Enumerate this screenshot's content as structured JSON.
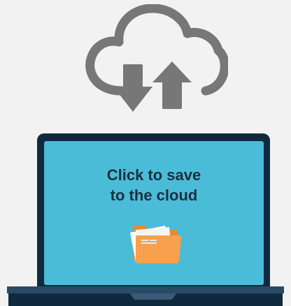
{
  "screen": {
    "line1": "Click to save",
    "line2": "to the cloud"
  },
  "icons": {
    "cloud": "cloud-sync-icon",
    "download": "download-arrow-icon",
    "upload": "upload-arrow-icon",
    "folder": "folder-icon"
  },
  "colors": {
    "background": "#f2f2f2",
    "cloud": "#777777",
    "bezel": "#0f2a3f",
    "screen": "#4bbcd8",
    "text": "#1b2f3e",
    "folder": "#f7a04d",
    "folder_back": "#e68a33",
    "base": "#2a4a66"
  }
}
